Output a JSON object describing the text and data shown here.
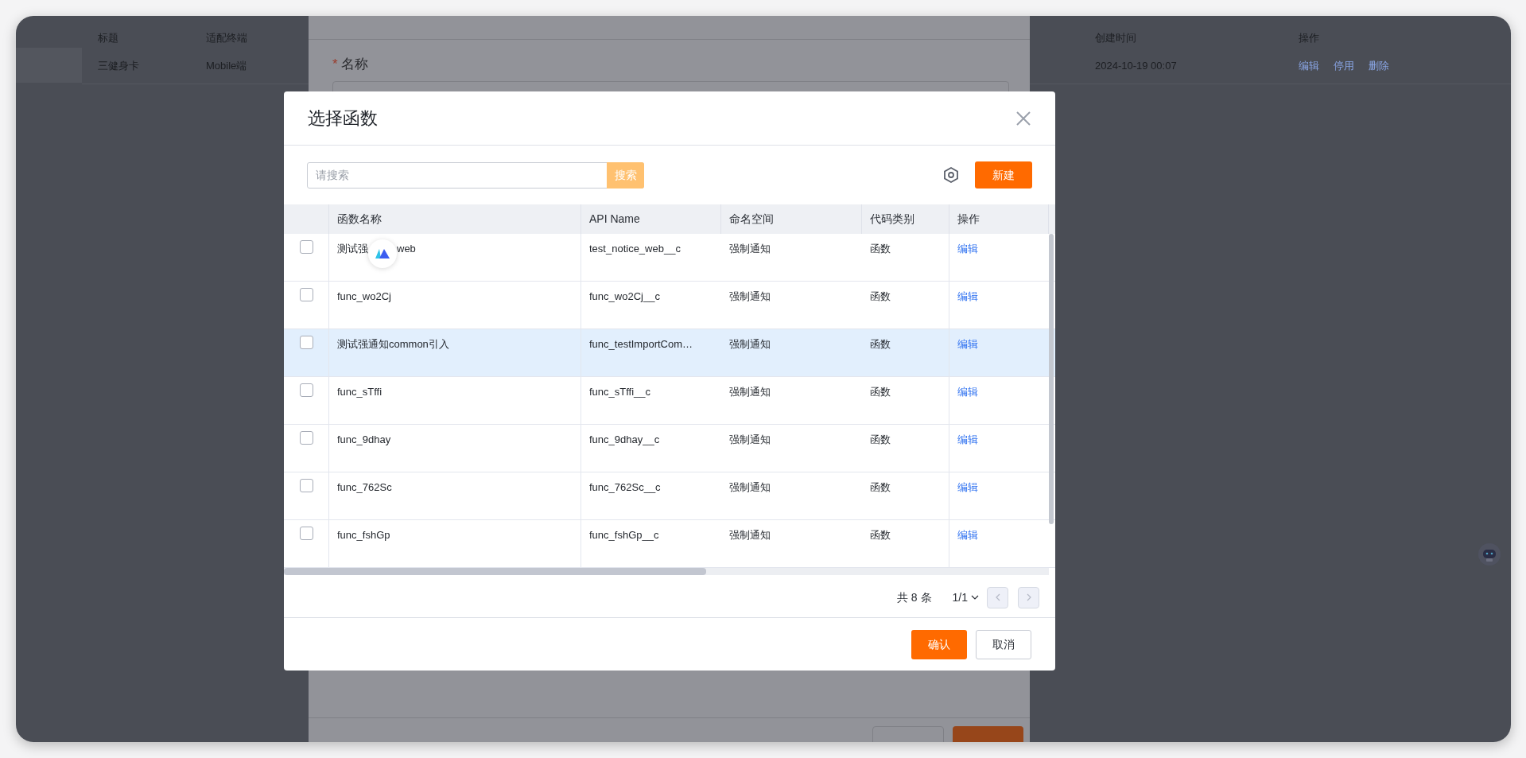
{
  "background_table": {
    "columns": [
      "标题",
      "适配终端",
      "创建时间",
      "操作"
    ],
    "rows": [
      {
        "title": "三健身卡",
        "terminal": "Mobile端",
        "created": "2024-10-19 00:07",
        "actions": [
          "编辑",
          "停用",
          "删除"
        ]
      }
    ]
  },
  "background_dialog": {
    "field_label": "名称",
    "required_mark": "*"
  },
  "dialog": {
    "title": "选择函数",
    "search": {
      "placeholder": "请搜索",
      "button": "搜索"
    },
    "new_button": "新建",
    "table": {
      "columns": [
        "函数名称",
        "API Name",
        "命名空间",
        "代码类别",
        "操作"
      ],
      "rows": [
        {
          "name": "测试强",
          "name_continued": "web",
          "api_name": "test_notice_web__c",
          "namespace": "强制通知",
          "code_type": "函数",
          "action": "编辑",
          "checked": false,
          "highlighted": false
        },
        {
          "name": "func_wo2Cj",
          "api_name": "func_wo2Cj__c",
          "namespace": "强制通知",
          "code_type": "函数",
          "action": "编辑",
          "checked": false,
          "highlighted": false
        },
        {
          "name": "测试强通知common引入",
          "api_name": "func_testImportCom…",
          "namespace": "强制通知",
          "code_type": "函数",
          "action": "编辑",
          "checked": false,
          "highlighted": true
        },
        {
          "name": "func_sTffi",
          "api_name": "func_sTffi__c",
          "namespace": "强制通知",
          "code_type": "函数",
          "action": "编辑",
          "checked": false,
          "highlighted": false
        },
        {
          "name": "func_9dhay",
          "api_name": "func_9dhay__c",
          "namespace": "强制通知",
          "code_type": "函数",
          "action": "编辑",
          "checked": false,
          "highlighted": false
        },
        {
          "name": "func_762Sc",
          "api_name": "func_762Sc__c",
          "namespace": "强制通知",
          "code_type": "函数",
          "action": "编辑",
          "checked": false,
          "highlighted": false
        },
        {
          "name": "func_fshGp",
          "api_name": "func_fshGp__c",
          "namespace": "强制通知",
          "code_type": "函数",
          "action": "编辑",
          "checked": false,
          "highlighted": false
        }
      ]
    },
    "pagination": {
      "total": "共 8 条",
      "page": "1/1"
    },
    "buttons": {
      "confirm": "确认",
      "cancel": "取消"
    }
  }
}
